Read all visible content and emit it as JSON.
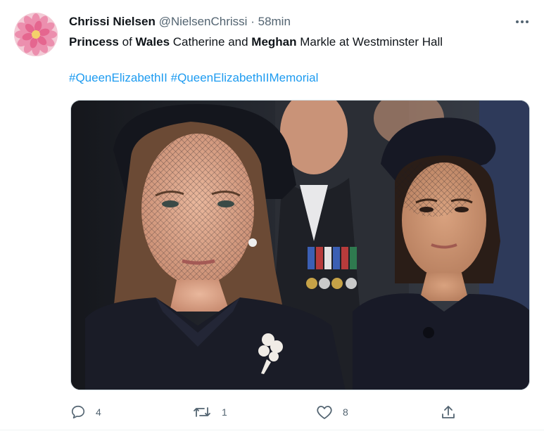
{
  "tweet": {
    "author_name": "Chrissi Nielsen",
    "handle": "@NielsenChrissi",
    "separator": "·",
    "time": "58min",
    "text": {
      "w1": "Princess",
      "w2": " of ",
      "w3": "Wales",
      "w4": " Catherine and ",
      "w5": "Meghan",
      "w6": " Markle at Westminster Hall"
    },
    "hashtags": [
      "#QueenElizabethII",
      "#QueenElizabethIIMemorial"
    ]
  },
  "actions": {
    "reply_count": "4",
    "retweet_count": "1",
    "like_count": "8"
  },
  "icons": {
    "more": "more-options-icon",
    "reply": "reply-icon",
    "retweet": "retweet-icon",
    "like": "heart-icon",
    "share": "share-icon"
  },
  "colors": {
    "link": "#1d9bf0",
    "secondary_text": "#536471",
    "avatar_flower": "#e86a8f"
  }
}
